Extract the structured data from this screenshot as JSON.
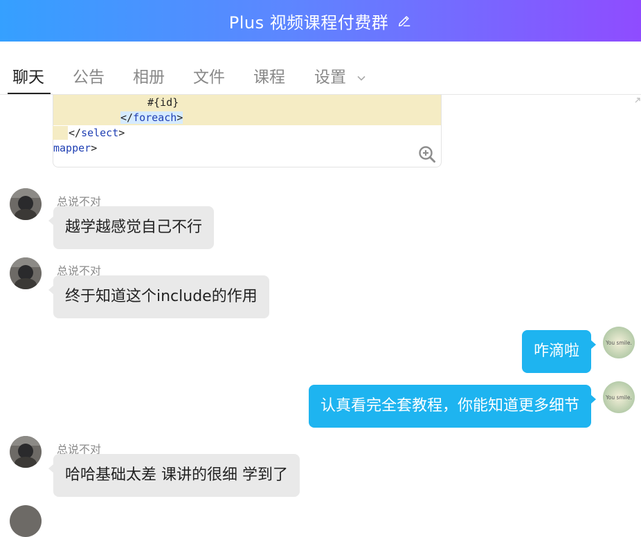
{
  "header": {
    "title": "Plus 视频课程付费群",
    "edit_icon": "pencil-icon"
  },
  "tabs": [
    {
      "label": "聊天",
      "active": true
    },
    {
      "label": "公告"
    },
    {
      "label": "相册"
    },
    {
      "label": "文件"
    },
    {
      "label": "课程"
    },
    {
      "label": "设置"
    }
  ],
  "code_snippet": {
    "line1": "#{id}",
    "line2_tag": "foreach",
    "line3_tag": "select",
    "line4_tag": "mapper"
  },
  "messages": [
    {
      "side": "left",
      "sender": "总说不对",
      "text": "越学越感觉自己不行"
    },
    {
      "side": "left",
      "sender": "总说不对",
      "text": "终于知道这个include的作用"
    },
    {
      "side": "right",
      "text": "咋滴啦",
      "avatar_text": "You smile."
    },
    {
      "side": "right",
      "text": "认真看完全套教程，你能知道更多细节",
      "avatar_text": "You smile."
    },
    {
      "side": "left",
      "sender": "总说不对",
      "text": "哈哈基础太差 课讲的很细 学到了"
    }
  ],
  "colors": {
    "header_start": "#35a0ff",
    "header_end": "#8f4cff",
    "self_bubble": "#1eb4f0",
    "other_bubble": "#e9e9e9"
  }
}
